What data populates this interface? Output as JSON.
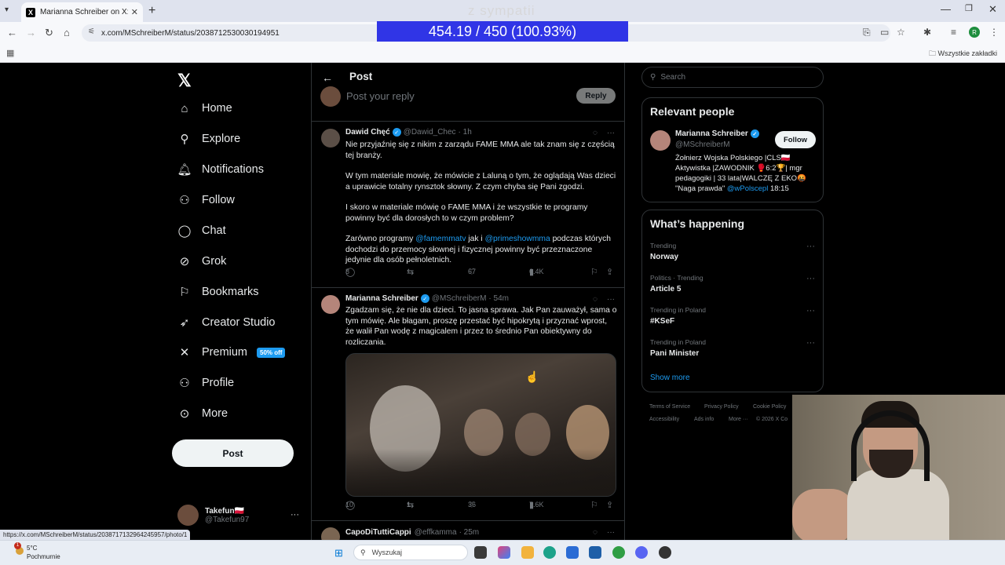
{
  "browser": {
    "tab_title": "Marianna Schreiber on X: \"A kto",
    "url": "x.com/MSchreiberM/status/2038712530030194951",
    "bookmarks_all": "Wszystkie zakładki",
    "profile_initial": "R",
    "status_url": "https://x.com/MSchreiberM/status/2038717132964245957/photo/1"
  },
  "overlay": {
    "title": "z sympatii",
    "progress_text": "454.19 / 450 (100.93%)",
    "progress_fraction": 1.0093,
    "color": "#3035e6"
  },
  "sidebar": {
    "items": [
      {
        "label": "Home",
        "icon": "home-icon",
        "glyph": "⌂"
      },
      {
        "label": "Explore",
        "icon": "search-icon",
        "glyph": "⚲"
      },
      {
        "label": "Notifications",
        "icon": "bell-icon",
        "glyph": "♫"
      },
      {
        "label": "Follow",
        "icon": "follow-icon",
        "glyph": "⚉"
      },
      {
        "label": "Chat",
        "icon": "chat-icon",
        "glyph": "◯"
      },
      {
        "label": "Grok",
        "icon": "grok-icon",
        "glyph": "⊘"
      },
      {
        "label": "Bookmarks",
        "icon": "bookmark-icon",
        "glyph": "⚐"
      },
      {
        "label": "Creator Studio",
        "icon": "rocket-icon",
        "glyph": "➶"
      },
      {
        "label": "Premium",
        "icon": "x-icon",
        "glyph": "✕"
      },
      {
        "label": "Profile",
        "icon": "profile-icon",
        "glyph": "⚇"
      },
      {
        "label": "More",
        "icon": "more-icon",
        "glyph": "⊙"
      }
    ],
    "premium_badge": "50% off",
    "post_button": "Post",
    "account": {
      "name": "Takefun🇵🇱",
      "handle": "@Takefun97",
      "more": "···"
    }
  },
  "main": {
    "header": "Post",
    "reply_placeholder": "Post your reply",
    "reply_button": "Reply",
    "tweets": [
      {
        "name": "Dawid Chęć",
        "handle": "@Dawid_Chec",
        "time": "· 1h",
        "paragraphs": [
          "Nie przyjaźnię się z nikim z zarządu FAME MMA ale tak znam się z częścią tej branży.",
          "W tym materiale mowię, że mówicie z Laluną o tym, że oglądają Was dzieci a uprawicie totalny rynsztok słowny. Z czym chyba się Pani zgodzi.",
          "I skoro w materiale mówię o FAME MMA i że wszystkie te programy powinny być dla dorosłych to w czym problem?"
        ],
        "last_pre": "Zarówno programy ",
        "mention1": "@famemmatv",
        "last_mid": " jak i ",
        "mention2": "@primeshowmma",
        "last_post": " podczas których dochodzi do przemocy słownej i fizycznej powinny być przeznaczone jedynie dla osób pełnoletnich.",
        "replies": "8",
        "reposts": "",
        "likes": "67",
        "views": "6.4K"
      },
      {
        "name": "Marianna Schreiber",
        "handle": "@MSchreiberM",
        "time": "· 54m",
        "text": "Zgadzam się, że nie dla dzieci. To jasna sprawa. Jak Pan zauważył, sama o tym mówię. Ale błagam, proszę przestać być hipokrytą i przyznać wprost, że walił Pan wodę z magicalem i przez to średnio Pan obiektywny do rozliczania.",
        "replies": "10",
        "reposts": "1",
        "likes": "36",
        "views": "7.6K"
      },
      {
        "name": "CapoDiTuttiCappi",
        "handle": "@effkamma",
        "time": "· 25m"
      }
    ]
  },
  "right": {
    "search_placeholder": "Search",
    "relevant_title": "Relevant people",
    "person": {
      "name": "Marianna Schreiber",
      "handle": "@MSchreiberM",
      "follow": "Follow",
      "bio": "Żołnierz Wojska Polskiego |CLS🇵🇱 Aktywistka |ZAWODNIK 🥊6:2🏆| mgr pedagogiki | 33 lata|WALCZĘ Z EKO🤬 \"Naga prawda\" ",
      "bio_mention": "@wPolscepl",
      "bio_tail": " 18:15"
    },
    "happening_title": "What’s happening",
    "trends": [
      {
        "meta": "Trending",
        "title": "Norway"
      },
      {
        "meta": "Politics · Trending",
        "title": "Article 5"
      },
      {
        "meta": "Trending in Poland",
        "title": "#KSeF"
      },
      {
        "meta": "Trending in Poland",
        "title": "Pani Minister"
      }
    ],
    "show_more": "Show more",
    "footer": {
      "terms": "Terms of Service",
      "privacy": "Privacy Policy",
      "cookie": "Cookie Policy",
      "accessibility": "Accessibility",
      "ads": "Ads info",
      "more": "More ···",
      "copyright": "© 2026 X Co"
    }
  },
  "taskbar": {
    "temp": "5°C",
    "weather": "Pochmurnie",
    "weather_badge": "1",
    "search_placeholder": "Wyszukaj"
  }
}
